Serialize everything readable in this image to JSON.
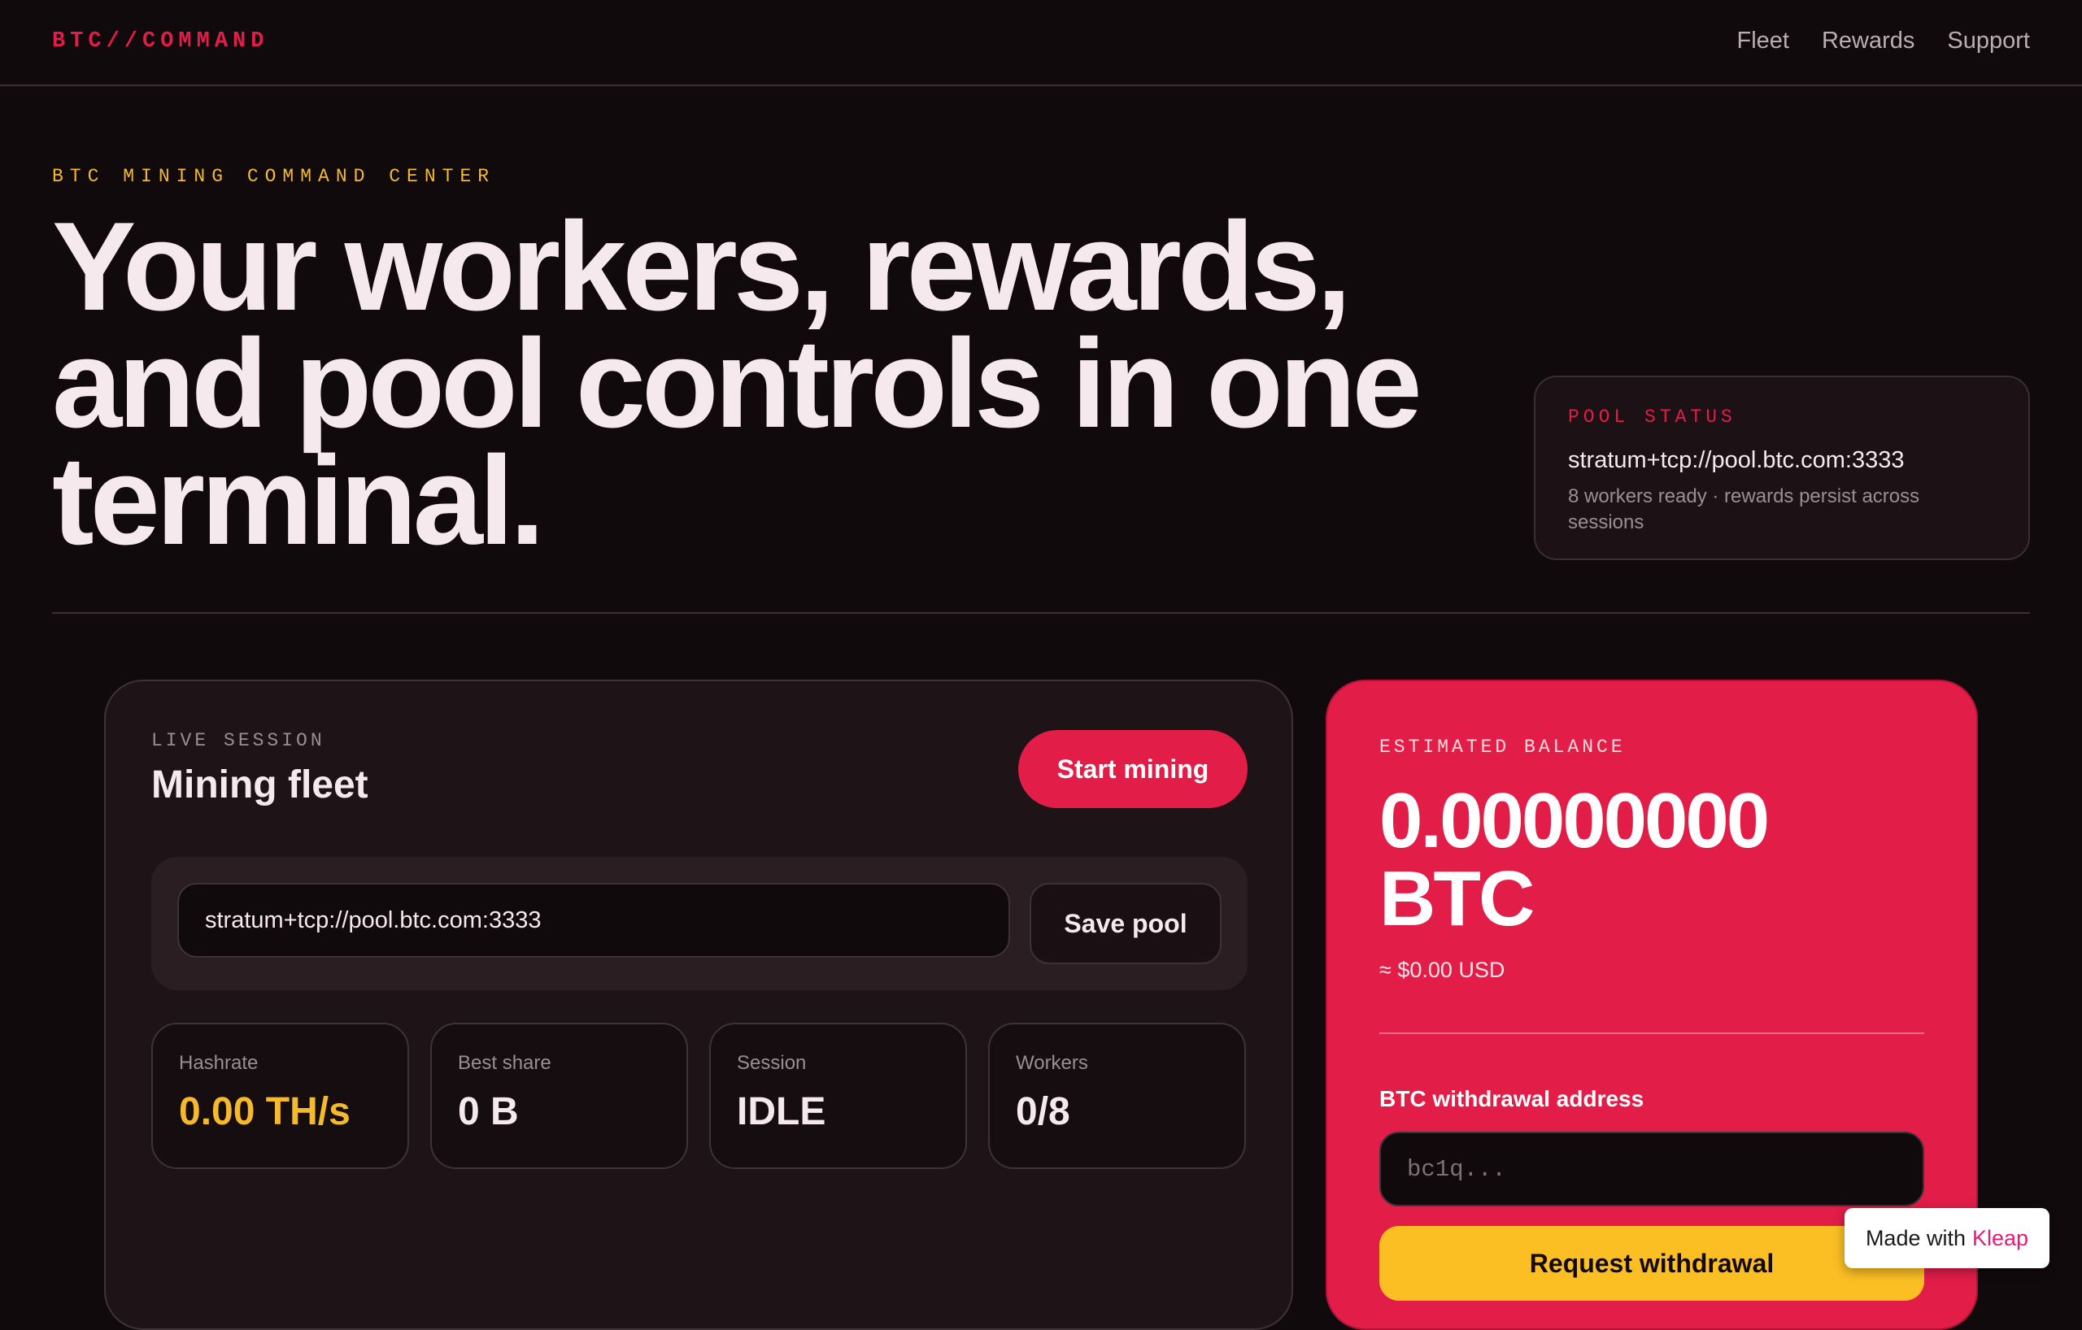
{
  "header": {
    "logo": "BTC//COMMAND",
    "nav": [
      "Fleet",
      "Rewards",
      "Support"
    ]
  },
  "hero": {
    "eyebrow": "BTC MINING COMMAND CENTER",
    "title_lines": [
      "Your workers, rewards,",
      "and pool controls in one",
      "terminal."
    ]
  },
  "pool_status": {
    "label": "POOL STATUS",
    "url": "stratum+tcp://pool.btc.com:3333",
    "meta": "8 workers ready · rewards persist across sessions"
  },
  "fleet": {
    "kicker": "LIVE SESSION",
    "title": "Mining fleet",
    "start_label": "Start mining",
    "pool_input_value": "stratum+tcp://pool.btc.com:3333",
    "save_label": "Save pool",
    "stats": [
      {
        "label": "Hashrate",
        "value": "0.00 TH/s"
      },
      {
        "label": "Best share",
        "value": "0 B"
      },
      {
        "label": "Session",
        "value": "IDLE"
      },
      {
        "label": "Workers",
        "value": "0/8"
      }
    ]
  },
  "balance": {
    "kicker": "ESTIMATED BALANCE",
    "amount_line1": "0.00000000",
    "amount_line2": "BTC",
    "usd": "≈ $0.00 USD",
    "address_label": "BTC withdrawal address",
    "address_placeholder": "bc1q...",
    "withdraw_label": "Request withdrawal"
  },
  "badge": {
    "prefix": "Made with",
    "brand": "Kleap"
  },
  "colors": {
    "background": "#110a0d",
    "accent_red": "#e11d48",
    "accent_yellow": "#f4b92c",
    "panel": "#1e1418"
  }
}
